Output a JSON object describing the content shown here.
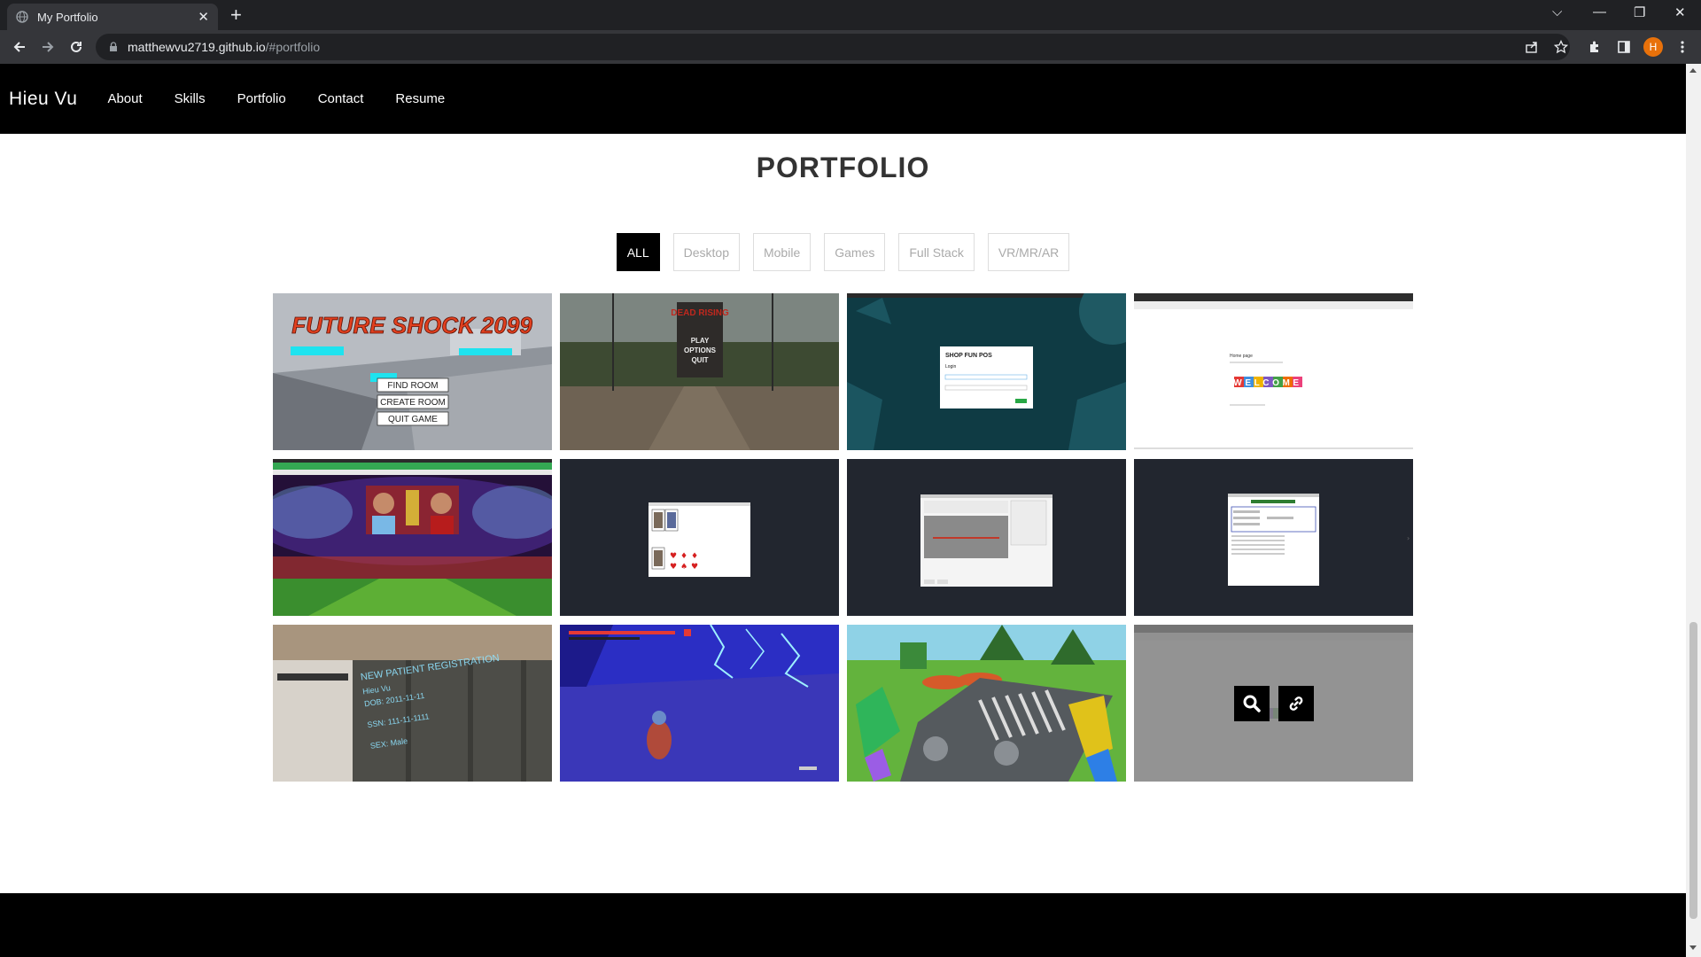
{
  "browser": {
    "tab_title": "My Portfolio",
    "url_host": "matthewvu2719.github.io",
    "url_path": "/#portfolio",
    "profile_initial": "H"
  },
  "site": {
    "brand": "Hieu Vu",
    "nav": [
      "About",
      "Skills",
      "Portfolio",
      "Contact",
      "Resume"
    ]
  },
  "portfolio": {
    "title": "PORTFOLIO",
    "filters": [
      "ALL",
      "Desktop",
      "Mobile",
      "Games",
      "Full Stack",
      "VR/MR/AR"
    ],
    "active_filter": "ALL",
    "items": {
      "fs_title": "FUTURE SHOCK 2099",
      "fs_menu": [
        "FIND ROOM",
        "CREATE ROOM",
        "QUIT GAME"
      ],
      "dr_title": "DEAD RISING",
      "dr_menu": [
        "PLAY",
        "OPTIONS",
        "QUIT"
      ],
      "shop_title": "SHOP FUN POS",
      "shop_login": "Login",
      "welcome_heading": "Home page",
      "welcome_word": "WELCOME",
      "vr_title": "NEW PATIENT REGISTRATION",
      "vr_lines": [
        "Hieu Vu",
        "DOB: 2011-11-11",
        "SSN: 111-11-1111",
        "SEX: Male"
      ],
      "hovered_item": 12
    }
  }
}
